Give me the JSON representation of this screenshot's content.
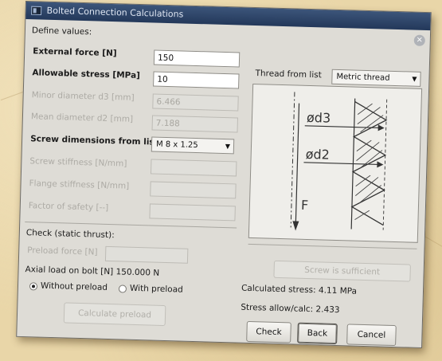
{
  "window": {
    "title": "Bolted Connection Calculations"
  },
  "define": {
    "heading": "Define values:"
  },
  "external_force": {
    "label": "External force [N]",
    "value": "150"
  },
  "allowable_stress": {
    "label": "Allowable stress [MPa]",
    "value": "10"
  },
  "minor_diameter": {
    "label": "Minor diameter d3 [mm]",
    "value": "6.466"
  },
  "mean_diameter": {
    "label": "Mean diameter d2 [mm]",
    "value": "7.188"
  },
  "screw_dims": {
    "label": "Screw dimensions from list",
    "selected": "M 8 x 1.25"
  },
  "screw_stiffness": {
    "label": "Screw stiffness [N/mm]",
    "value": ""
  },
  "flange_stiffness": {
    "label": "Flange stiffness [N/mm]",
    "value": ""
  },
  "safety_factor": {
    "label": "Factor of safety [--]",
    "value": ""
  },
  "thread": {
    "label": "Thread from list",
    "selected": "Metric thread"
  },
  "diagram": {
    "d3": "ød3",
    "d2": "ød2",
    "force": "F"
  },
  "check": {
    "heading": "Check (static thrust):",
    "preload_label": "Preload force [N]",
    "preload_value": "",
    "axial_load": "Axial load on bolt [N] 150.000 N",
    "radio_without": "Without preload",
    "radio_with": "With preload",
    "calc_preload_btn": "Calculate preload"
  },
  "results": {
    "status_btn": "Screw is sufficient",
    "calc_stress": "Calculated stress: 4.11 MPa",
    "ratio": "Stress allow/calc: 2.433"
  },
  "buttons": {
    "check": "Check",
    "back": "Back",
    "cancel": "Cancel"
  },
  "colors": {
    "titlebar": "#2f4668",
    "dialog_bg": "#dedcd6",
    "desk": "#e9d6a8"
  }
}
